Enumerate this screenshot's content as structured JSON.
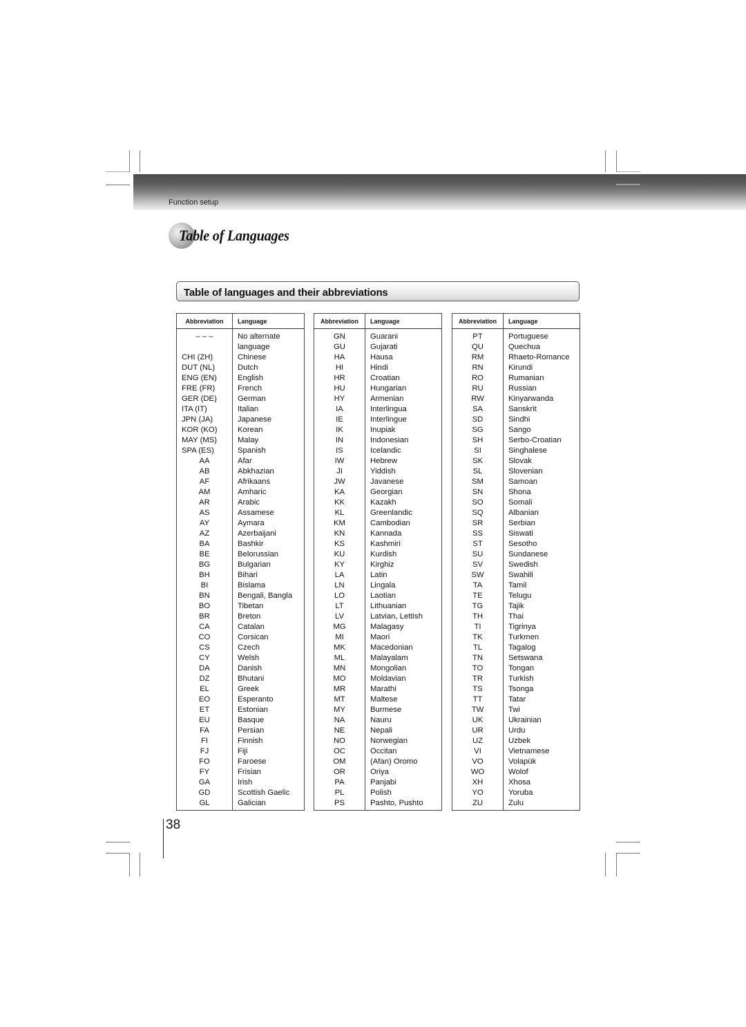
{
  "header": {
    "section": "Function setup",
    "title": "Table of Languages"
  },
  "subheading": "Table of languages and their abbreviations",
  "table_headers": {
    "abbreviation": "Abbreviation",
    "language": "Language"
  },
  "columns": [
    [
      {
        "abbr": "– – –",
        "lang": "No alternate"
      },
      {
        "abbr": "",
        "lang": "language"
      },
      {
        "abbr": "CHI (ZH)",
        "lang": "Chinese"
      },
      {
        "abbr": "DUT (NL)",
        "lang": "Dutch"
      },
      {
        "abbr": "ENG (EN)",
        "lang": "English"
      },
      {
        "abbr": "FRE (FR)",
        "lang": "French"
      },
      {
        "abbr": "GER (DE)",
        "lang": "German"
      },
      {
        "abbr": "ITA (IT)",
        "lang": "Italian"
      },
      {
        "abbr": "JPN (JA)",
        "lang": "Japanese"
      },
      {
        "abbr": "KOR (KO)",
        "lang": "Korean"
      },
      {
        "abbr": "MAY (MS)",
        "lang": "Malay"
      },
      {
        "abbr": "SPA (ES)",
        "lang": "Spanish"
      },
      {
        "abbr": "AA",
        "lang": "Afar"
      },
      {
        "abbr": "AB",
        "lang": "Abkhazian"
      },
      {
        "abbr": "AF",
        "lang": "Afrikaans"
      },
      {
        "abbr": "AM",
        "lang": "Amharic"
      },
      {
        "abbr": "AR",
        "lang": "Arabic"
      },
      {
        "abbr": "AS",
        "lang": "Assamese"
      },
      {
        "abbr": "AY",
        "lang": "Aymara"
      },
      {
        "abbr": "AZ",
        "lang": "Azerbaijani"
      },
      {
        "abbr": "BA",
        "lang": "Bashkir"
      },
      {
        "abbr": "BE",
        "lang": "Belorussian"
      },
      {
        "abbr": "BG",
        "lang": "Bulgarian"
      },
      {
        "abbr": "BH",
        "lang": "Bihari"
      },
      {
        "abbr": "BI",
        "lang": "Bislama"
      },
      {
        "abbr": "BN",
        "lang": "Bengali, Bangla"
      },
      {
        "abbr": "BO",
        "lang": "Tibetan"
      },
      {
        "abbr": "BR",
        "lang": "Breton"
      },
      {
        "abbr": "CA",
        "lang": "Catalan"
      },
      {
        "abbr": "CO",
        "lang": "Corsican"
      },
      {
        "abbr": "CS",
        "lang": "Czech"
      },
      {
        "abbr": "CY",
        "lang": "Welsh"
      },
      {
        "abbr": "DA",
        "lang": "Danish"
      },
      {
        "abbr": "DZ",
        "lang": "Bhutani"
      },
      {
        "abbr": "EL",
        "lang": "Greek"
      },
      {
        "abbr": "EO",
        "lang": "Esperanto"
      },
      {
        "abbr": "ET",
        "lang": "Estonian"
      },
      {
        "abbr": "EU",
        "lang": "Basque"
      },
      {
        "abbr": "FA",
        "lang": "Persian"
      },
      {
        "abbr": "FI",
        "lang": "Finnish"
      },
      {
        "abbr": "FJ",
        "lang": "Fiji"
      },
      {
        "abbr": "FO",
        "lang": "Faroese"
      },
      {
        "abbr": "FY",
        "lang": "Frisian"
      },
      {
        "abbr": "GA",
        "lang": "Irish"
      },
      {
        "abbr": "GD",
        "lang": "Scottish Gaelic"
      },
      {
        "abbr": "GL",
        "lang": "Galician"
      }
    ],
    [
      {
        "abbr": "GN",
        "lang": "Guarani"
      },
      {
        "abbr": "GU",
        "lang": "Gujarati"
      },
      {
        "abbr": "HA",
        "lang": "Hausa"
      },
      {
        "abbr": "HI",
        "lang": "Hindi"
      },
      {
        "abbr": "HR",
        "lang": "Croatian"
      },
      {
        "abbr": "HU",
        "lang": "Hungarian"
      },
      {
        "abbr": "HY",
        "lang": "Armenian"
      },
      {
        "abbr": "IA",
        "lang": "Interlingua"
      },
      {
        "abbr": "IE",
        "lang": "Interlingue"
      },
      {
        "abbr": "IK",
        "lang": "Inupiak"
      },
      {
        "abbr": "IN",
        "lang": "Indonesian"
      },
      {
        "abbr": "IS",
        "lang": "Icelandic"
      },
      {
        "abbr": "IW",
        "lang": "Hebrew"
      },
      {
        "abbr": "JI",
        "lang": "Yiddish"
      },
      {
        "abbr": "JW",
        "lang": "Javanese"
      },
      {
        "abbr": "KA",
        "lang": "Georgian"
      },
      {
        "abbr": "KK",
        "lang": "Kazakh"
      },
      {
        "abbr": "KL",
        "lang": "Greenlandic"
      },
      {
        "abbr": "KM",
        "lang": "Cambodian"
      },
      {
        "abbr": "KN",
        "lang": "Kannada"
      },
      {
        "abbr": "KS",
        "lang": "Kashmiri"
      },
      {
        "abbr": "KU",
        "lang": "Kurdish"
      },
      {
        "abbr": "KY",
        "lang": "Kirghiz"
      },
      {
        "abbr": "LA",
        "lang": "Latin"
      },
      {
        "abbr": "LN",
        "lang": "Lingala"
      },
      {
        "abbr": "LO",
        "lang": "Laotian"
      },
      {
        "abbr": "LT",
        "lang": "Lithuanian"
      },
      {
        "abbr": "LV",
        "lang": "Latvian, Lettish"
      },
      {
        "abbr": "MG",
        "lang": "Malagasy"
      },
      {
        "abbr": "MI",
        "lang": "Maori"
      },
      {
        "abbr": "MK",
        "lang": "Macedonian"
      },
      {
        "abbr": "ML",
        "lang": "Malayalam"
      },
      {
        "abbr": "MN",
        "lang": "Mongolian"
      },
      {
        "abbr": "MO",
        "lang": "Moldavian"
      },
      {
        "abbr": "MR",
        "lang": "Marathi"
      },
      {
        "abbr": "MT",
        "lang": "Maltese"
      },
      {
        "abbr": "MY",
        "lang": "Burmese"
      },
      {
        "abbr": "NA",
        "lang": "Nauru"
      },
      {
        "abbr": "NE",
        "lang": "Nepali"
      },
      {
        "abbr": "NO",
        "lang": "Norwegian"
      },
      {
        "abbr": "OC",
        "lang": "Occitan"
      },
      {
        "abbr": "OM",
        "lang": "(Afan) Oromo"
      },
      {
        "abbr": "OR",
        "lang": "Oriya"
      },
      {
        "abbr": "PA",
        "lang": "Panjabi"
      },
      {
        "abbr": "PL",
        "lang": "Polish"
      },
      {
        "abbr": "PS",
        "lang": "Pashto, Pushto"
      }
    ],
    [
      {
        "abbr": "PT",
        "lang": "Portuguese"
      },
      {
        "abbr": "QU",
        "lang": "Quechua"
      },
      {
        "abbr": "RM",
        "lang": "Rhaeto-Romance"
      },
      {
        "abbr": "RN",
        "lang": "Kirundi"
      },
      {
        "abbr": "RO",
        "lang": "Rumanian"
      },
      {
        "abbr": "RU",
        "lang": "Russian"
      },
      {
        "abbr": "RW",
        "lang": "Kinyarwanda"
      },
      {
        "abbr": "SA",
        "lang": "Sanskrit"
      },
      {
        "abbr": "SD",
        "lang": "Sindhi"
      },
      {
        "abbr": "SG",
        "lang": "Sango"
      },
      {
        "abbr": "SH",
        "lang": "Serbo-Croatian"
      },
      {
        "abbr": "SI",
        "lang": "Singhalese"
      },
      {
        "abbr": "SK",
        "lang": "Slovak"
      },
      {
        "abbr": "SL",
        "lang": "Slovenian"
      },
      {
        "abbr": "SM",
        "lang": "Samoan"
      },
      {
        "abbr": "SN",
        "lang": "Shona"
      },
      {
        "abbr": "SO",
        "lang": "Somali"
      },
      {
        "abbr": "SQ",
        "lang": "Albanian"
      },
      {
        "abbr": "SR",
        "lang": "Serbian"
      },
      {
        "abbr": "SS",
        "lang": "Siswati"
      },
      {
        "abbr": "ST",
        "lang": "Sesotho"
      },
      {
        "abbr": "SU",
        "lang": "Sundanese"
      },
      {
        "abbr": "SV",
        "lang": "Swedish"
      },
      {
        "abbr": "SW",
        "lang": "Swahili"
      },
      {
        "abbr": "TA",
        "lang": "Tamil"
      },
      {
        "abbr": "TE",
        "lang": "Telugu"
      },
      {
        "abbr": "TG",
        "lang": "Tajik"
      },
      {
        "abbr": "TH",
        "lang": "Thai"
      },
      {
        "abbr": "TI",
        "lang": "Tigrinya"
      },
      {
        "abbr": "TK",
        "lang": "Turkmen"
      },
      {
        "abbr": "TL",
        "lang": "Tagalog"
      },
      {
        "abbr": "TN",
        "lang": "Setswana"
      },
      {
        "abbr": "TO",
        "lang": "Tongan"
      },
      {
        "abbr": "TR",
        "lang": "Turkish"
      },
      {
        "abbr": "TS",
        "lang": "Tsonga"
      },
      {
        "abbr": "TT",
        "lang": "Tatar"
      },
      {
        "abbr": "TW",
        "lang": "Twi"
      },
      {
        "abbr": "UK",
        "lang": "Ukrainian"
      },
      {
        "abbr": "UR",
        "lang": "Urdu"
      },
      {
        "abbr": "UZ",
        "lang": "Uzbek"
      },
      {
        "abbr": "VI",
        "lang": "Vietnamese"
      },
      {
        "abbr": "VO",
        "lang": "Volapük"
      },
      {
        "abbr": "WO",
        "lang": "Wolof"
      },
      {
        "abbr": "XH",
        "lang": "Xhosa"
      },
      {
        "abbr": "YO",
        "lang": "Yoruba"
      },
      {
        "abbr": "ZU",
        "lang": "Zulu"
      }
    ]
  ],
  "page_number": "38"
}
